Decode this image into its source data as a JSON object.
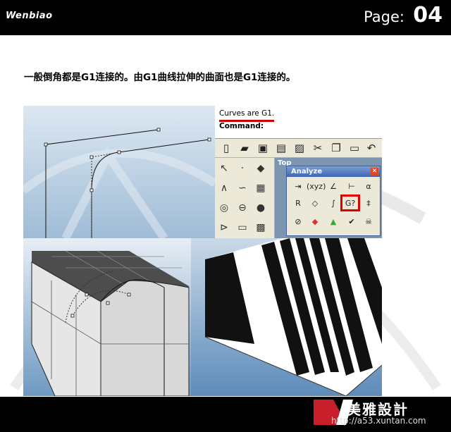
{
  "header": {
    "brand": "Wenbiao",
    "page_label": "Page:",
    "page_number": "04"
  },
  "caption": "一般倒角都是G1连接的。由G1曲线拉伸的曲面也是G1连接的。",
  "rhino": {
    "command_output": "Curves are G1.",
    "command_prompt": "Command:",
    "viewport_label": "Top",
    "analyze_title": "Analyze",
    "analyze_buttons": [
      "(xyz)",
      "G?"
    ]
  },
  "footer": {
    "logo_text": "美雅設計",
    "url": "http://a53.xuntan.com"
  },
  "colors": {
    "accent_red": "#e00000",
    "bar": "#000000"
  }
}
